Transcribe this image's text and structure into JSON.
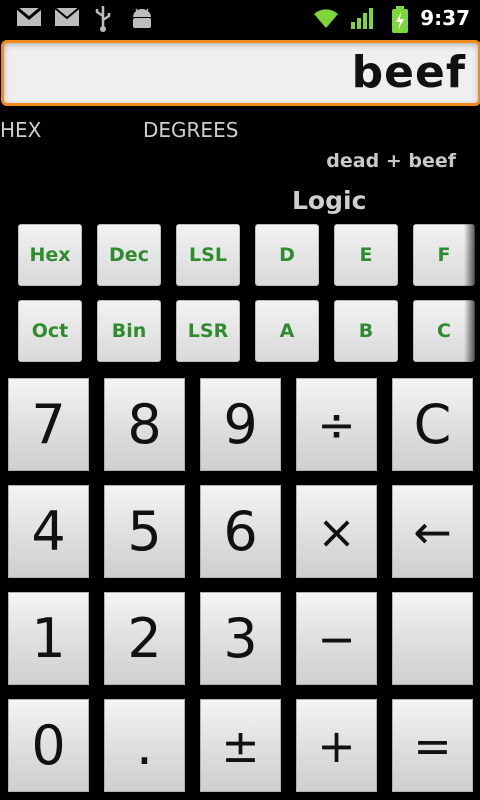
{
  "status_bar": {
    "time": "9:37",
    "icons": [
      "gmail-icon",
      "email-icon",
      "usb-icon",
      "android-debug-icon",
      "wifi-icon",
      "signal-icon",
      "battery-charging-icon"
    ]
  },
  "display": {
    "value": "beef"
  },
  "modes": {
    "base": "HEX",
    "angle": "DEGREES"
  },
  "history": "dead + beef",
  "panel": {
    "title": "Logic",
    "row1": [
      "Hex",
      "Dec",
      "LSL",
      "D",
      "E",
      "F"
    ],
    "row2": [
      "Oct",
      "Bin",
      "LSR",
      "A",
      "B",
      "C"
    ]
  },
  "keypad": {
    "row1": [
      "7",
      "8",
      "9",
      "÷",
      "C"
    ],
    "row2": [
      "4",
      "5",
      "6",
      "×",
      "←"
    ],
    "row3": [
      "1",
      "2",
      "3",
      "−",
      ""
    ],
    "row4": [
      "0",
      ".",
      "±",
      "+",
      "="
    ]
  },
  "colors": {
    "accent": "#f08a1c",
    "function_text": "#2e8b2e",
    "background": "#000000"
  }
}
